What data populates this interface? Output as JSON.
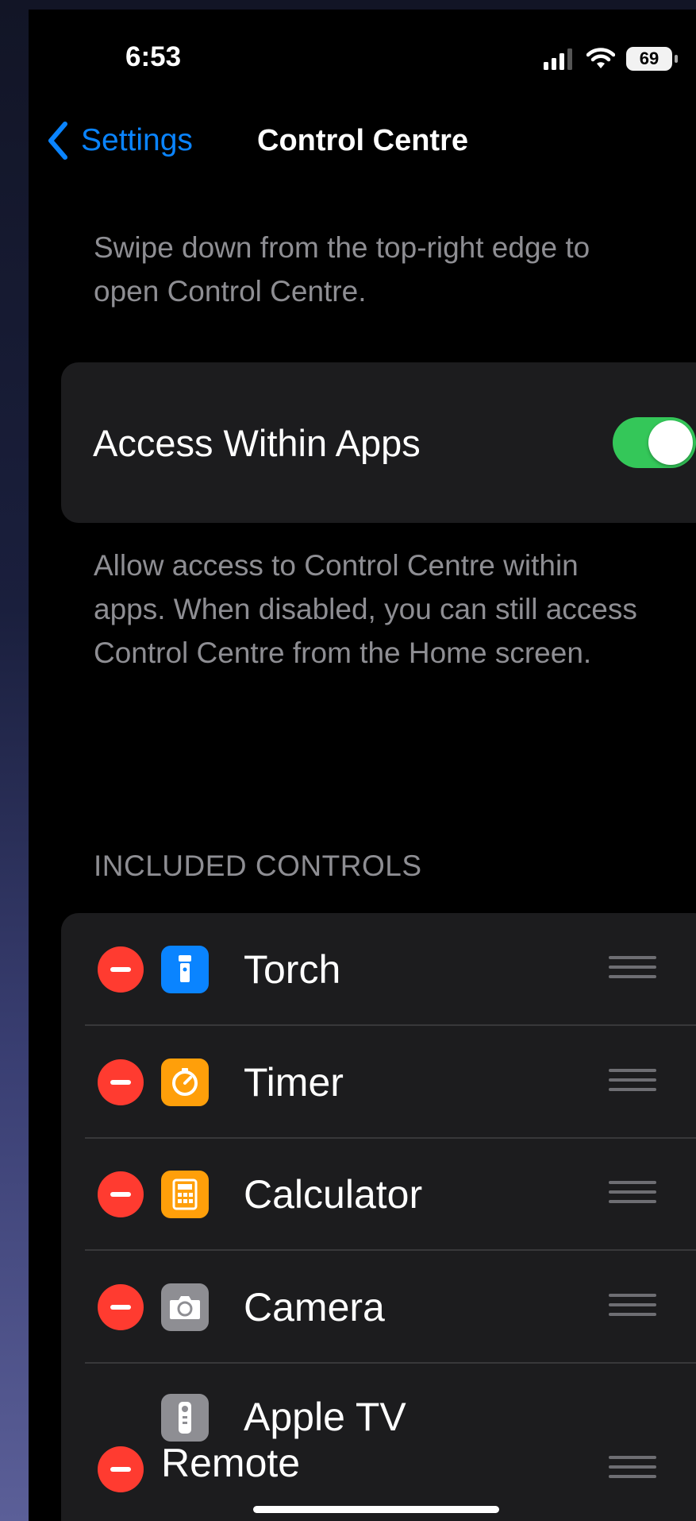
{
  "status_bar": {
    "time": "6:53",
    "battery": "69"
  },
  "nav": {
    "back_label": "Settings",
    "title": "Control Centre"
  },
  "intro_text": "Swipe down from the top-right edge to open Control Centre.",
  "access_within_apps": {
    "label": "Access Within Apps",
    "enabled": true
  },
  "help_text": "Allow access to Control Centre within apps. When disabled, you can still access Control Centre from the Home screen.",
  "included_controls": {
    "header": "INCLUDED CONTROLS",
    "items": [
      {
        "label": "Torch",
        "icon": "torch-icon",
        "color": "#0a84ff"
      },
      {
        "label": "Timer",
        "icon": "timer-icon",
        "color": "#ff9f0a"
      },
      {
        "label": "Calculator",
        "icon": "calculator-icon",
        "color": "#ff9f0a"
      },
      {
        "label": "Camera",
        "icon": "camera-icon",
        "color": "#8e8e93"
      },
      {
        "label_line1": "Apple TV",
        "label_line2": "Remote",
        "icon": "tv-remote-icon",
        "color": "#8e8e93"
      }
    ]
  },
  "colors": {
    "accent": "#0a84ff",
    "toggle_on": "#34c759",
    "remove": "#ff3b30"
  }
}
